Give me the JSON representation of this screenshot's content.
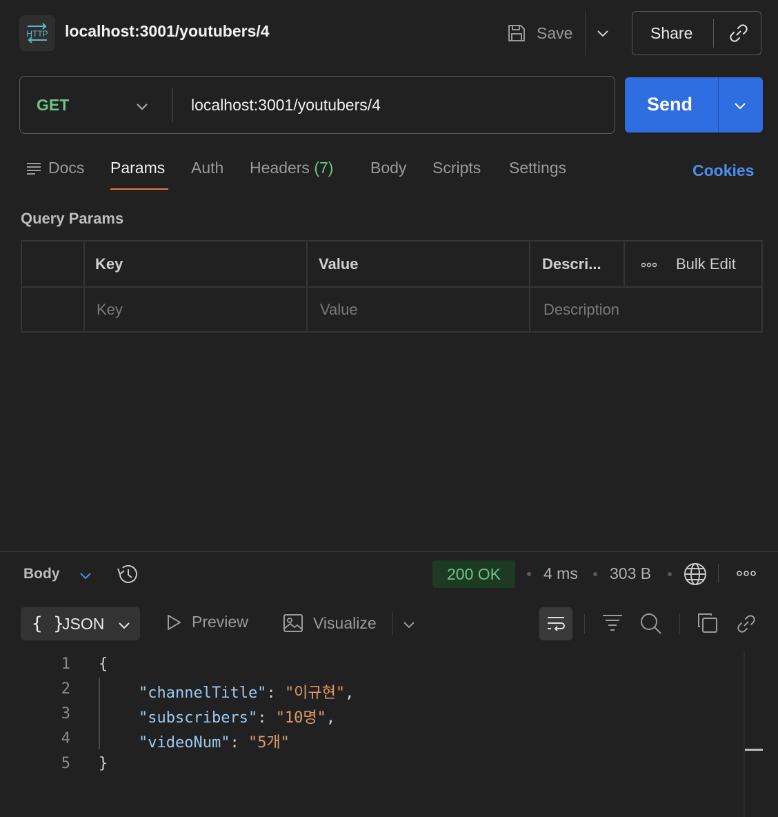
{
  "header": {
    "icon_text": "HTTP",
    "title": "localhost:3001/youtubers/4",
    "save_label": "Save",
    "share_label": "Share"
  },
  "request": {
    "method": "GET",
    "url": "localhost:3001/youtubers/4",
    "send_label": "Send"
  },
  "tabs": {
    "docs": "Docs",
    "params": "Params",
    "auth": "Auth",
    "headers": "Headers",
    "headers_count": "(7)",
    "body": "Body",
    "scripts": "Scripts",
    "settings": "Settings",
    "cookies": "Cookies",
    "active": "Params"
  },
  "query_params": {
    "title": "Query Params",
    "columns": {
      "key": "Key",
      "value": "Value",
      "description": "Descri..."
    },
    "bulk_edit": "Bulk Edit",
    "placeholders": {
      "key": "Key",
      "value": "Value",
      "description": "Description"
    }
  },
  "response": {
    "body_label": "Body",
    "status": "200 OK",
    "time": "4 ms",
    "size": "303 B",
    "format_brace": "{ }",
    "format": "JSON",
    "preview": "Preview",
    "visualize": "Visualize",
    "lines": [
      {
        "num": "1",
        "text": "{"
      },
      {
        "num": "2",
        "key": "\"channelTitle\"",
        "value": "\"이규현\"",
        "trail": ","
      },
      {
        "num": "3",
        "key": "\"subscribers\"",
        "value": "\"10명\"",
        "trail": ","
      },
      {
        "num": "4",
        "key": "\"videoNum\"",
        "value": "\"5개\"",
        "trail": ""
      },
      {
        "num": "5",
        "text": "}"
      }
    ]
  },
  "colors": {
    "background": "#212121",
    "method_green": "#6cc487",
    "send_blue": "#2f6ee0",
    "tab_accent": "#e8743b",
    "cookies_blue": "#4e8ef0",
    "json_key": "#9cc9f0",
    "json_string": "#e29a6b"
  }
}
